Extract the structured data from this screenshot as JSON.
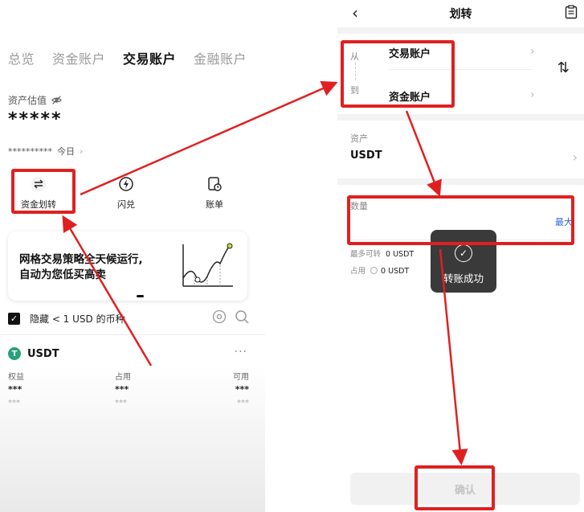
{
  "left": {
    "tabs": [
      "总览",
      "资金账户",
      "交易账户",
      "金融账户"
    ],
    "active_tab": "交易账户",
    "asset_label": "资产估值",
    "masked_balance": "*****",
    "pnl_masked": "**********",
    "pnl_period": "今日",
    "quick_actions": [
      {
        "label": "资金划转",
        "icon": "transfer-icon"
      },
      {
        "label": "闪兑",
        "icon": "flash-convert-icon"
      },
      {
        "label": "账单",
        "icon": "bill-icon"
      }
    ],
    "banner": {
      "line1": "网格交易策略全天候运行,",
      "line2": "自动为您低买高卖"
    },
    "hide_small": {
      "checked": true,
      "label": "隐藏 < 1 USD 的币种"
    },
    "coin": {
      "symbol": "USDT",
      "more": "···",
      "columns": [
        "权益",
        "占用",
        "可用"
      ],
      "values": [
        "***",
        "***",
        "***"
      ],
      "sub_values": [
        "***",
        "***",
        "***"
      ]
    }
  },
  "right": {
    "title": "划转",
    "from_label": "从",
    "to_label": "到",
    "from_account": "交易账户",
    "to_account": "资金账户",
    "asset_header": "资产",
    "asset_value": "USDT",
    "qty_header": "数量",
    "qty_value": "",
    "qty_max": "最大",
    "avail_label": "最多可转",
    "avail_value": "0 USDT",
    "occupied_label": "占用",
    "occupied_value": "0 USDT",
    "toast": "转账成功",
    "confirm": "确认"
  },
  "colors": {
    "annotation": "#e02020",
    "accent": "#2c63d9",
    "usdt": "#26a17b"
  }
}
